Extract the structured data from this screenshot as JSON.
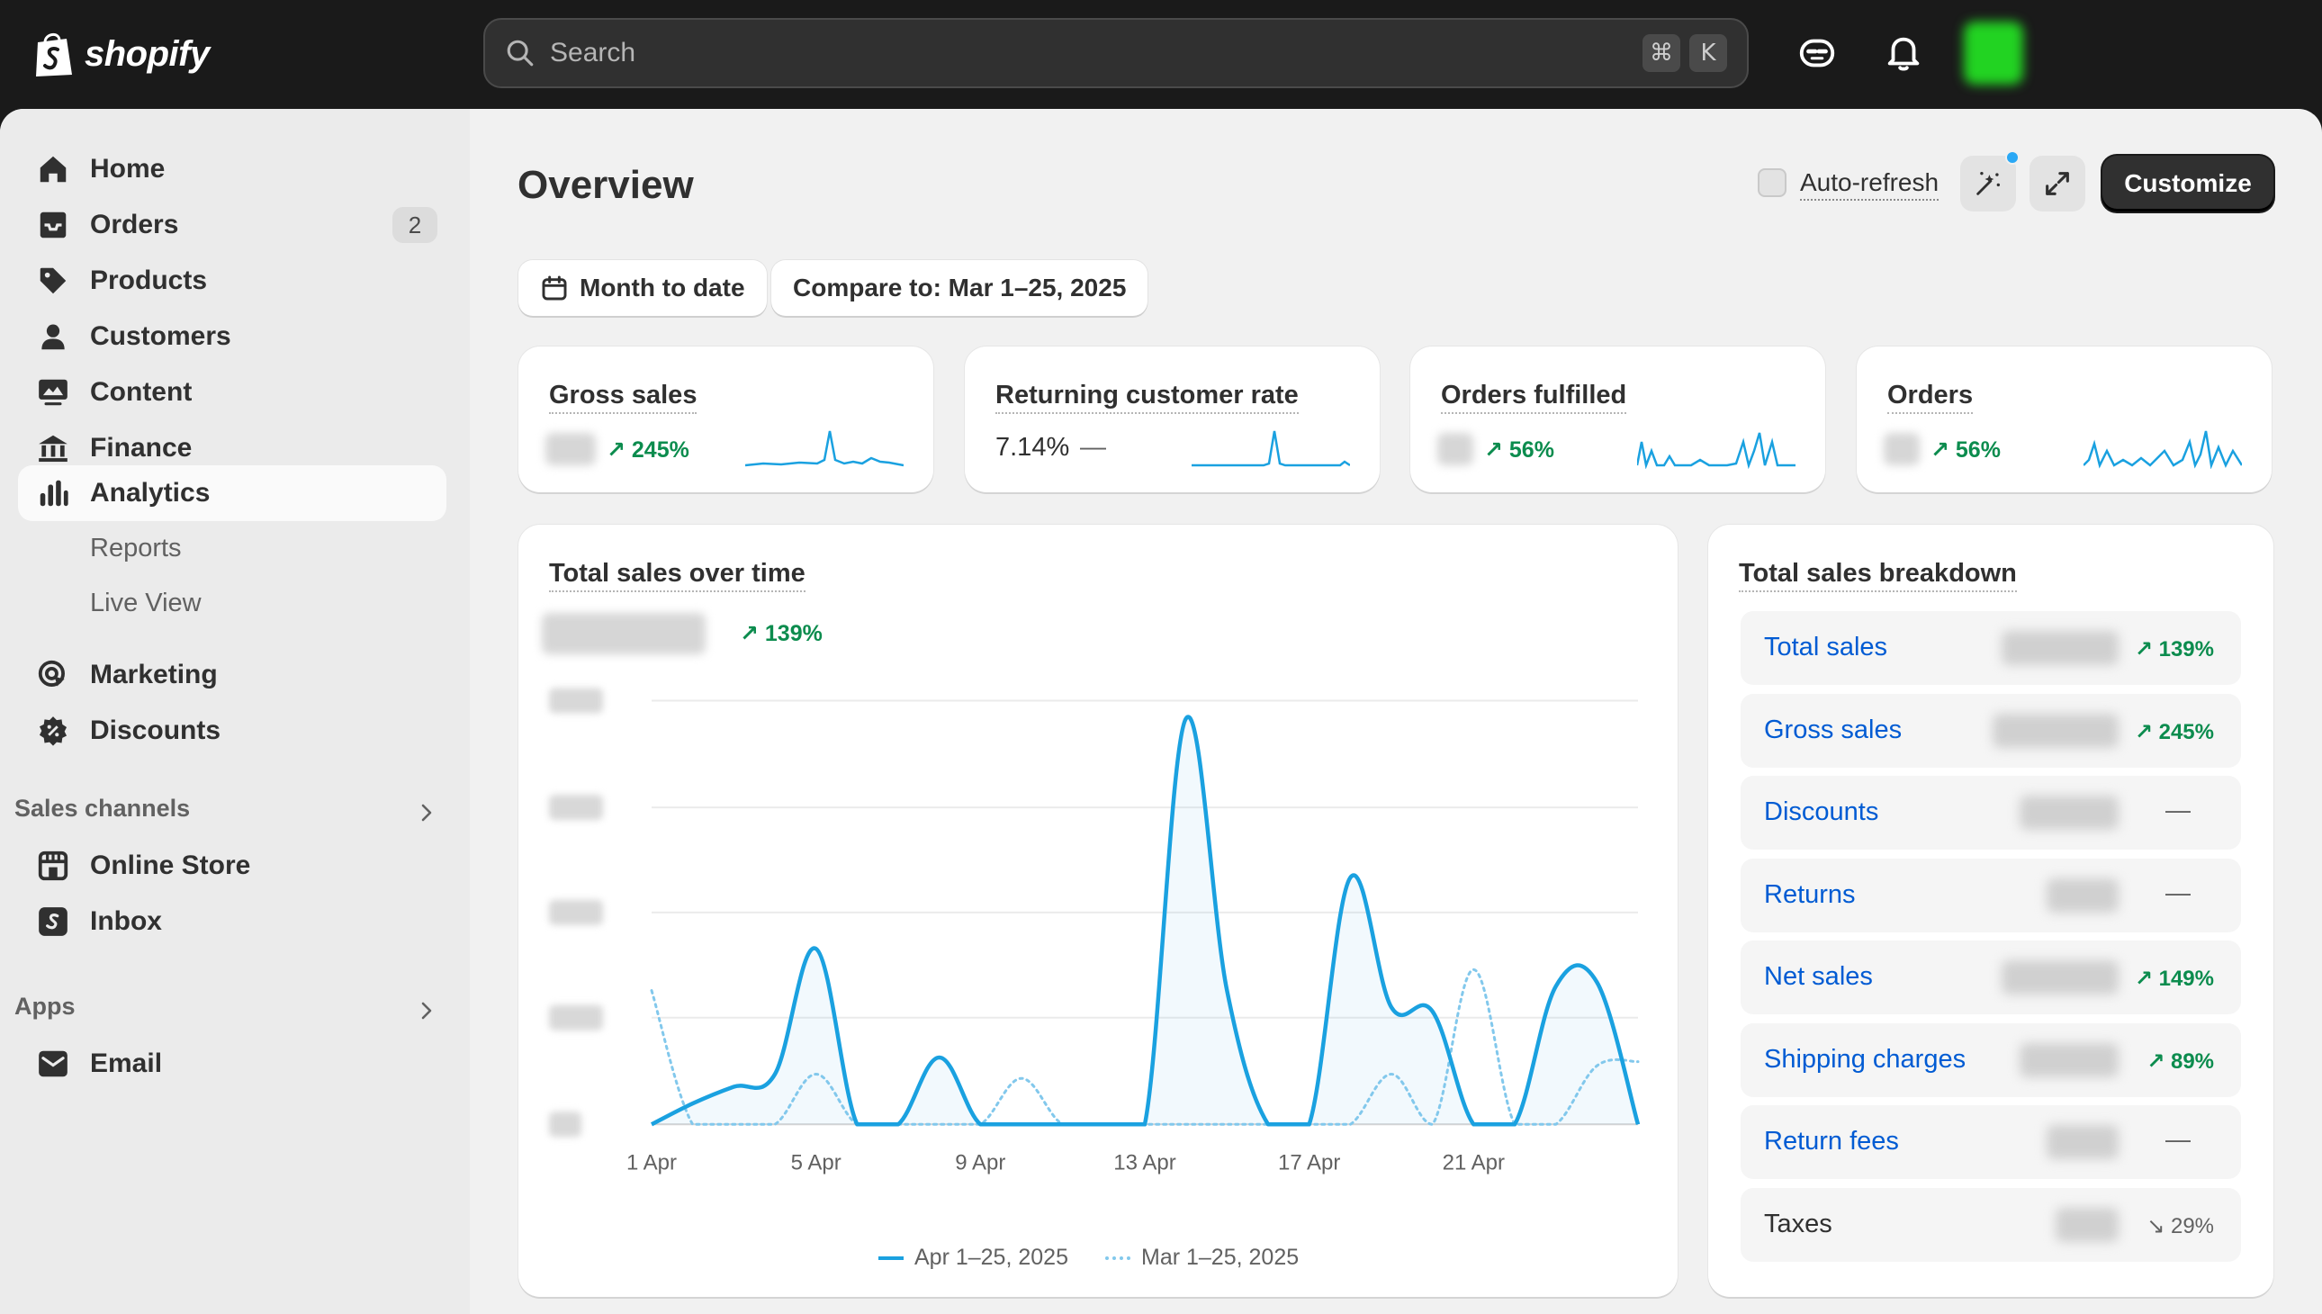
{
  "app": {
    "brand": "shopify",
    "search_placeholder": "Search",
    "search_shortcut": [
      "⌘",
      "K"
    ]
  },
  "sidebar": {
    "items": [
      {
        "label": "Home",
        "icon": "home-icon"
      },
      {
        "label": "Orders",
        "icon": "orders-icon",
        "badge": "2"
      },
      {
        "label": "Products",
        "icon": "tag-icon"
      },
      {
        "label": "Customers",
        "icon": "person-icon"
      },
      {
        "label": "Content",
        "icon": "content-icon"
      },
      {
        "label": "Finance",
        "icon": "bank-icon"
      },
      {
        "label": "Analytics",
        "icon": "bar-chart-icon",
        "active": true
      }
    ],
    "analytics_sub": [
      "Reports",
      "Live View"
    ],
    "more_items": [
      {
        "label": "Marketing",
        "icon": "target-icon"
      },
      {
        "label": "Discounts",
        "icon": "discount-icon"
      }
    ],
    "sales_channels_label": "Sales channels",
    "sales_channels": [
      {
        "label": "Online Store",
        "icon": "store-icon"
      },
      {
        "label": "Inbox",
        "icon": "inbox-icon"
      }
    ],
    "apps_label": "Apps",
    "apps": [
      {
        "label": "Email",
        "icon": "email-icon"
      }
    ]
  },
  "page": {
    "title": "Overview",
    "auto_refresh_label": "Auto-refresh",
    "customize_label": "Customize",
    "date_range_label": "Month to date",
    "compare_label": "Compare to: Mar 1–25, 2025"
  },
  "metrics": [
    {
      "title": "Gross sales",
      "delta": "↗ 245%"
    },
    {
      "title": "Returning customer rate",
      "value": "7.14%",
      "delta": "—"
    },
    {
      "title": "Orders fulfilled",
      "delta": "↗ 56%"
    },
    {
      "title": "Orders",
      "delta": "↗ 56%"
    }
  ],
  "total_sales": {
    "title": "Total sales over time",
    "delta": "↗ 139%",
    "legend_current": "Apr 1–25, 2025",
    "legend_previous": "Mar 1–25, 2025"
  },
  "chart_data": {
    "type": "line",
    "title": "Total sales over time",
    "x_tick_labels": [
      "1 Apr",
      "5 Apr",
      "9 Apr",
      "13 Apr",
      "17 Apr",
      "21 Apr"
    ],
    "x": [
      1,
      2,
      3,
      4,
      5,
      6,
      7,
      8,
      9,
      10,
      11,
      12,
      13,
      14,
      15,
      16,
      17,
      18,
      19,
      20,
      21,
      22,
      23,
      24,
      25
    ],
    "y_range_relative": [
      0,
      1
    ],
    "grid": true,
    "legend_position": "bottom",
    "series": [
      {
        "name": "Apr 1–25, 2025",
        "style": "solid",
        "color": "#1aa1e0",
        "values": [
          0,
          0.05,
          0.09,
          0.12,
          0.42,
          0,
          0,
          0.16,
          0,
          0,
          0,
          0,
          0,
          0.97,
          0.32,
          0,
          0,
          0.59,
          0.28,
          0.27,
          0,
          0,
          0.33,
          0.34,
          0
        ]
      },
      {
        "name": "Mar 1–25, 2025",
        "style": "dotted",
        "color": "#82c8ec",
        "values": [
          0.32,
          0,
          0,
          0,
          0.12,
          0,
          0,
          0,
          0,
          0.11,
          0,
          0,
          0,
          0,
          0,
          0,
          0,
          0,
          0.12,
          0,
          0.37,
          0,
          0,
          0.14,
          0.15
        ]
      }
    ]
  },
  "breakdown": {
    "title": "Total sales breakdown",
    "rows": [
      {
        "label": "Total sales",
        "delta": "↗ 139%",
        "trend": "up"
      },
      {
        "label": "Gross sales",
        "delta": "↗ 245%",
        "trend": "up"
      },
      {
        "label": "Discounts",
        "delta": "—",
        "trend": "neutral"
      },
      {
        "label": "Returns",
        "delta": "—",
        "trend": "neutral"
      },
      {
        "label": "Net sales",
        "delta": "↗ 149%",
        "trend": "up"
      },
      {
        "label": "Shipping charges",
        "delta": "↗ 89%",
        "trend": "up"
      },
      {
        "label": "Return fees",
        "delta": "—",
        "trend": "neutral"
      },
      {
        "label": "Taxes",
        "delta": "↘ 29%",
        "trend": "down"
      }
    ]
  },
  "colors": {
    "accent_link": "#005bd3",
    "positive": "#0c8c4e",
    "chart_line": "#1aa1e0"
  }
}
